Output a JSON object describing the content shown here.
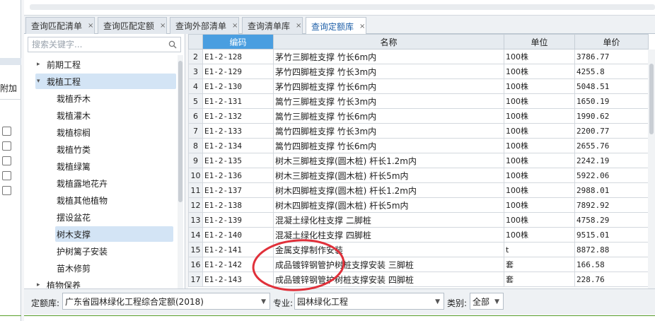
{
  "left_strip": {
    "label": "附加"
  },
  "tabs": [
    {
      "label": "查询匹配清单"
    },
    {
      "label": "查询匹配定额"
    },
    {
      "label": "查询外部清单"
    },
    {
      "label": "查询清单库"
    },
    {
      "label": "查询定额库"
    }
  ],
  "active_tab": 4,
  "tab_close": "×",
  "search": {
    "placeholder": "搜索关键字..."
  },
  "tree": [
    {
      "label": "前期工程",
      "level": 0,
      "arrow": "▸"
    },
    {
      "label": "栽植工程",
      "level": 0,
      "arrow": "▾",
      "selected": true
    },
    {
      "label": "栽植乔木",
      "level": 1
    },
    {
      "label": "栽植灌木",
      "level": 1
    },
    {
      "label": "栽植棕榈",
      "level": 1
    },
    {
      "label": "栽植竹类",
      "level": 1
    },
    {
      "label": "栽植绿篱",
      "level": 1
    },
    {
      "label": "栽植露地花卉",
      "level": 1
    },
    {
      "label": "栽植其他植物",
      "level": 1
    },
    {
      "label": "摆设盆花",
      "level": 1
    },
    {
      "label": "树木支撑",
      "level": 1,
      "selected": true
    },
    {
      "label": "护树篱子安装",
      "level": 1
    },
    {
      "label": "苗木修剪",
      "level": 1
    },
    {
      "label": "植物保养",
      "level": 0,
      "arrow": "▸"
    }
  ],
  "table": {
    "headers": [
      "编码",
      "名称",
      "单位",
      "单价"
    ],
    "rows": [
      {
        "no": "2",
        "code": "E1-2-128",
        "name": "茅竹三脚桩支撑 竹长6m内",
        "unit": "100株",
        "price": "3786.77"
      },
      {
        "no": "3",
        "code": "E1-2-129",
        "name": "茅竹四脚桩支撑 竹长3m内",
        "unit": "100株",
        "price": "4255.8"
      },
      {
        "no": "4",
        "code": "E1-2-130",
        "name": "茅竹四脚桩支撑 竹长6m内",
        "unit": "100株",
        "price": "5048.51"
      },
      {
        "no": "5",
        "code": "E1-2-131",
        "name": "篙竹三脚桩支撑 竹长3m内",
        "unit": "100株",
        "price": "1650.19"
      },
      {
        "no": "6",
        "code": "E1-2-132",
        "name": "篙竹三脚桩支撑 竹长6m内",
        "unit": "100株",
        "price": "1990.62"
      },
      {
        "no": "7",
        "code": "E1-2-133",
        "name": "篙竹四脚桩支撑 竹长3m内",
        "unit": "100株",
        "price": "2200.77"
      },
      {
        "no": "8",
        "code": "E1-2-134",
        "name": "篙竹四脚桩支撑 竹长6m内",
        "unit": "100株",
        "price": "2655.76"
      },
      {
        "no": "9",
        "code": "E1-2-135",
        "name": "树木三脚桩支撑(圆木桩) 杆长1.2m内",
        "unit": "100株",
        "price": "2242.19"
      },
      {
        "no": "10",
        "code": "E1-2-136",
        "name": "树木三脚桩支撑(圆木桩) 杆长5m内",
        "unit": "100株",
        "price": "5922.06"
      },
      {
        "no": "11",
        "code": "E1-2-137",
        "name": "树木四脚桩支撑(圆木桩) 杆长1.2m内",
        "unit": "100株",
        "price": "2988.01"
      },
      {
        "no": "12",
        "code": "E1-2-138",
        "name": "树木四脚桩支撑(圆木桩) 杆长5m内",
        "unit": "100株",
        "price": "7892.92"
      },
      {
        "no": "13",
        "code": "E1-2-139",
        "name": "混凝土绿化柱支撑 二脚桩",
        "unit": "100株",
        "price": "4758.29"
      },
      {
        "no": "14",
        "code": "E1-2-140",
        "name": "混凝土绿化柱支撑 四脚桩",
        "unit": "100株",
        "price": "9515.01"
      },
      {
        "no": "15",
        "code": "E1-2-141",
        "name": "金属支撑制作安装",
        "unit": "t",
        "price": "8872.88"
      },
      {
        "no": "16",
        "code": "E1-2-142",
        "name": "成品镀锌钢管护树桩支撑安装 三脚桩",
        "unit": "套",
        "price": "166.58"
      },
      {
        "no": "17",
        "code": "E1-2-143",
        "name": "成品镀锌钢管护树桩支撑安装 四脚桩",
        "unit": "套",
        "price": "228.76"
      }
    ]
  },
  "filters": {
    "quota_label": "定额库:",
    "quota_value": "广东省园林绿化工程综合定额(2018)",
    "major_label": "专业:",
    "major_value": "园林绿化工程",
    "category_label": "类别:",
    "category_value": "全部"
  },
  "colors": {
    "header_highlight": "#4a9ee0",
    "selection": "#d3e4f5",
    "annotation": "#e0303a"
  }
}
